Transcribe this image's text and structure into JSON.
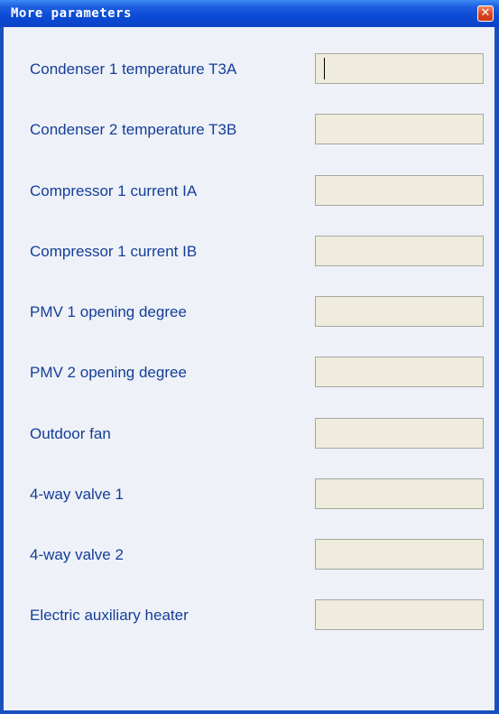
{
  "window": {
    "title": "More parameters",
    "close_symbol": "✕",
    "close_icon": "close-icon"
  },
  "params": [
    {
      "label": "Condenser 1 temperature T3A",
      "value": ""
    },
    {
      "label": "Condenser 2 temperature T3B",
      "value": ""
    },
    {
      "label": "Compressor 1 current IA",
      "value": ""
    },
    {
      "label": "Compressor 1 current IB",
      "value": ""
    },
    {
      "label": "PMV 1 opening degree",
      "value": ""
    },
    {
      "label": "PMV 2 opening degree",
      "value": ""
    },
    {
      "label": "Outdoor fan",
      "value": ""
    },
    {
      "label": "4-way valve 1",
      "value": ""
    },
    {
      "label": "4-way valve 2",
      "value": ""
    },
    {
      "label": "Electric auxiliary heater",
      "value": ""
    }
  ],
  "colors": {
    "title_bar": "#0a4ad6",
    "client_bg": "#eef2f8",
    "label_text": "#153d98",
    "field_bg": "#efebdd",
    "close_button": "#d9431c"
  }
}
